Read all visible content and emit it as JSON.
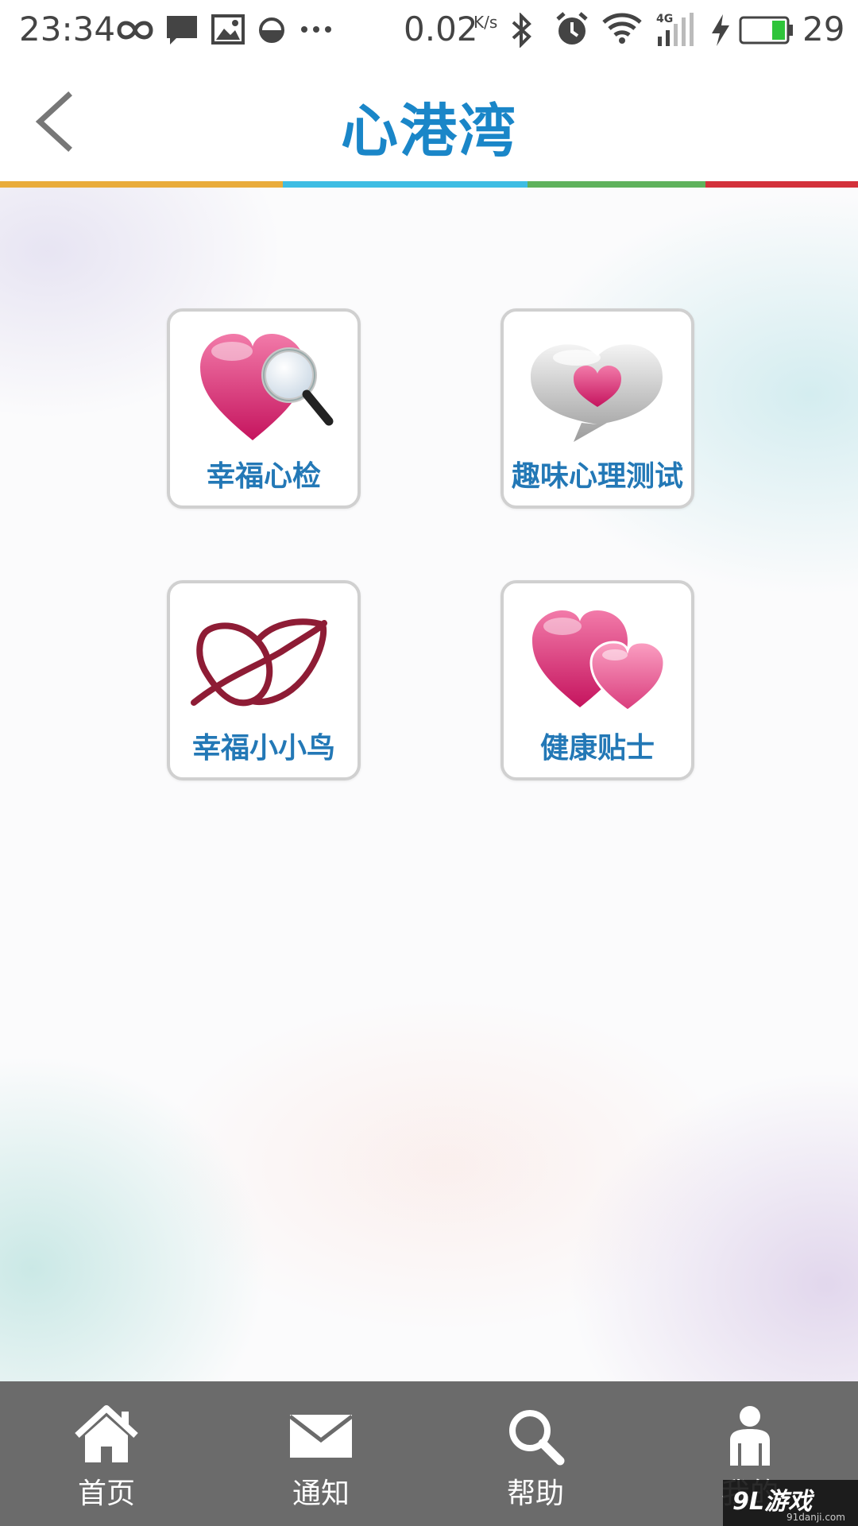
{
  "status_bar": {
    "time": "23:34",
    "net_speed": "0.02",
    "net_speed_unit": "K/s",
    "network_type": "4G",
    "battery_level": "29",
    "icons": [
      "infinity-icon",
      "message-icon",
      "image-icon",
      "half-circle-icon",
      "more-icon",
      "bluetooth-icon",
      "alarm-icon",
      "wifi-icon",
      "signal-icon",
      "charging-icon",
      "battery-icon"
    ]
  },
  "header": {
    "title": "心港湾",
    "back_icon": "chevron-left-icon",
    "stripe_colors": [
      "#e9ac3b",
      "#3ebde3",
      "#5fb25c",
      "#d3313a"
    ]
  },
  "tiles": [
    {
      "label": "幸福心检",
      "icon": "heart-magnifier-icon"
    },
    {
      "label": "趣味心理测试",
      "icon": "heart-speech-bubble-icon"
    },
    {
      "label": "幸福小小鸟",
      "icon": "heart-bird-icon"
    },
    {
      "label": "健康贴士",
      "icon": "double-heart-icon"
    }
  ],
  "bottom_nav": {
    "items": [
      {
        "label": "首页",
        "icon": "home-icon"
      },
      {
        "label": "通知",
        "icon": "envelope-icon"
      },
      {
        "label": "帮助",
        "icon": "search-icon"
      },
      {
        "label": "我的",
        "icon": "user-icon"
      }
    ]
  },
  "watermark": {
    "brand": "9L游戏",
    "site": "91danji.com"
  },
  "colors": {
    "title_blue": "#1a86c8",
    "label_blue": "#2378b6",
    "heart_pink": "#d9317a",
    "bird_red": "#8e1c35",
    "nav_bg": "#6b6b6b"
  }
}
